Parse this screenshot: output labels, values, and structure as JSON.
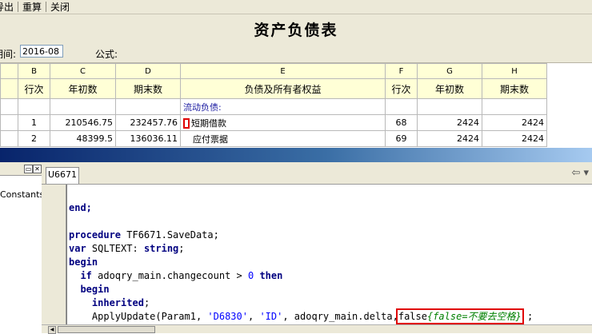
{
  "menu": {
    "export": "导出",
    "recalc": "重算",
    "close": "关闭"
  },
  "report": {
    "title": "资产负债表",
    "period_label": "期间:",
    "period_value": "2016-08",
    "formula_label": "公式:"
  },
  "grid": {
    "col_letters": [
      "",
      "B",
      "C",
      "D",
      "E",
      "F",
      "G",
      "H"
    ],
    "headers": [
      "",
      "行次",
      "年初数",
      "期末数",
      "负债及所有者权益",
      "行次",
      "年初数",
      "期末数"
    ],
    "rows": [
      {
        "b": "",
        "c": "",
        "d": "",
        "e": "流动负债:",
        "f": "",
        "g": "",
        "h": ""
      },
      {
        "b": "1",
        "c": "210546.75",
        "d": "232457.76",
        "e": "短期借款",
        "f": "68",
        "g": "2424",
        "h": "2424"
      },
      {
        "b": "2",
        "c": "48399.5",
        "d": "136036.11",
        "e": "应付票据",
        "f": "69",
        "g": "2424",
        "h": "2424"
      }
    ]
  },
  "ide": {
    "left_panel_text": "Constants",
    "tab_label": "U6671",
    "code": {
      "l1": "end;",
      "l3_kw": "procedure",
      "l3_rest": " TF6671.SaveData;",
      "l4_kw": "var",
      "l4_rest": " SQLTEXT: ",
      "l4_type": "string",
      "l4_end": ";",
      "l5": "begin",
      "l6_kw": "if",
      "l6_rest": " adoqry_main.changecount > ",
      "l6_num": "0",
      "l6_then": "then",
      "l7": "begin",
      "l8": "inherited",
      "l8_end": ";",
      "l9_pre": "ApplyUpdate(Param1, ",
      "l9_s1": "'D6830'",
      "l9_mid": ", ",
      "l9_s2": "'ID'",
      "l9_mid2": ", adoqry_main.delta,",
      "l9_false": "false",
      "l9_cmt": "{false=不要去空格}",
      "l9_end": ";"
    }
  }
}
